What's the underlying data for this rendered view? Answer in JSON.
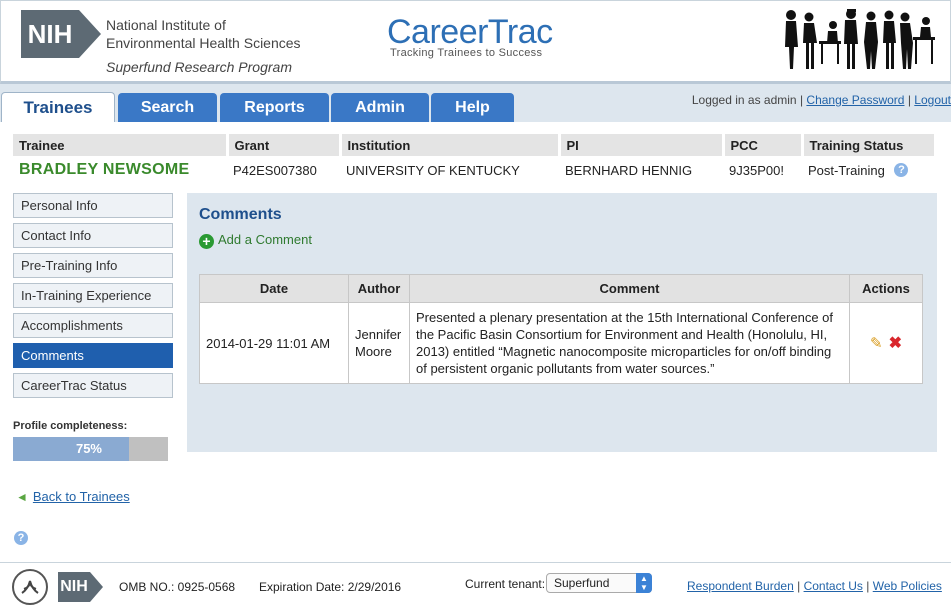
{
  "header": {
    "logo_text": "NIH",
    "institute_line1": "National Institute of",
    "institute_line2": "Environmental Health Sciences",
    "program": "Superfund Research Program",
    "app_title": "CareerTrac",
    "app_tagline": "Tracking Trainees to Success"
  },
  "nav": {
    "tabs": [
      {
        "label": "Trainees"
      },
      {
        "label": "Search"
      },
      {
        "label": "Reports"
      },
      {
        "label": "Admin"
      },
      {
        "label": "Help"
      }
    ],
    "logged_in_text": "Logged in as admin",
    "change_password": "Change Password",
    "logout": "Logout"
  },
  "summary": {
    "headers": [
      "Trainee",
      "Grant",
      "Institution",
      "PI",
      "PCC",
      "Training Status"
    ],
    "trainee": "BRADLEY NEWSOME",
    "grant": "P42ES007380",
    "institution": "UNIVERSITY OF KENTUCKY",
    "pi": "BERNHARD HENNIG",
    "pcc": "9J35P00!",
    "status": "Post-Training"
  },
  "sidebar": {
    "items": [
      {
        "label": "Personal Info"
      },
      {
        "label": "Contact Info"
      },
      {
        "label": "Pre-Training Info"
      },
      {
        "label": "In-Training Experience"
      },
      {
        "label": "Accomplishments"
      },
      {
        "label": "Comments"
      },
      {
        "label": "CareerTrac Status"
      }
    ],
    "active_index": 5,
    "profile_label": "Profile completeness:",
    "profile_value": 0.75,
    "profile_text": "75%",
    "back_link": "Back to Trainees"
  },
  "main": {
    "title": "Comments",
    "add_label": "Add a Comment",
    "columns": [
      "Date",
      "Author",
      "Comment",
      "Actions"
    ],
    "rows": [
      {
        "date": "2014-01-29 11:01 AM",
        "author": "Jennifer Moore",
        "comment": "Presented a plenary presentation at the 15th International Conference of the Pacific Basin Consortium for Environment and Health (Honolulu, HI, 2013) entitled “Magnetic nanocomposite microparticles for on/off binding of persistent organic pollutants from water sources.”"
      }
    ]
  },
  "footer": {
    "nih": "NIH",
    "omb": "OMB NO.: 0925-0568",
    "expiration": "Expiration Date: 2/29/2016",
    "tenant_label": "Current tenant:",
    "tenant_value": "Superfund",
    "links": [
      "Respondent Burden",
      "Contact Us",
      "Web Policies"
    ]
  }
}
